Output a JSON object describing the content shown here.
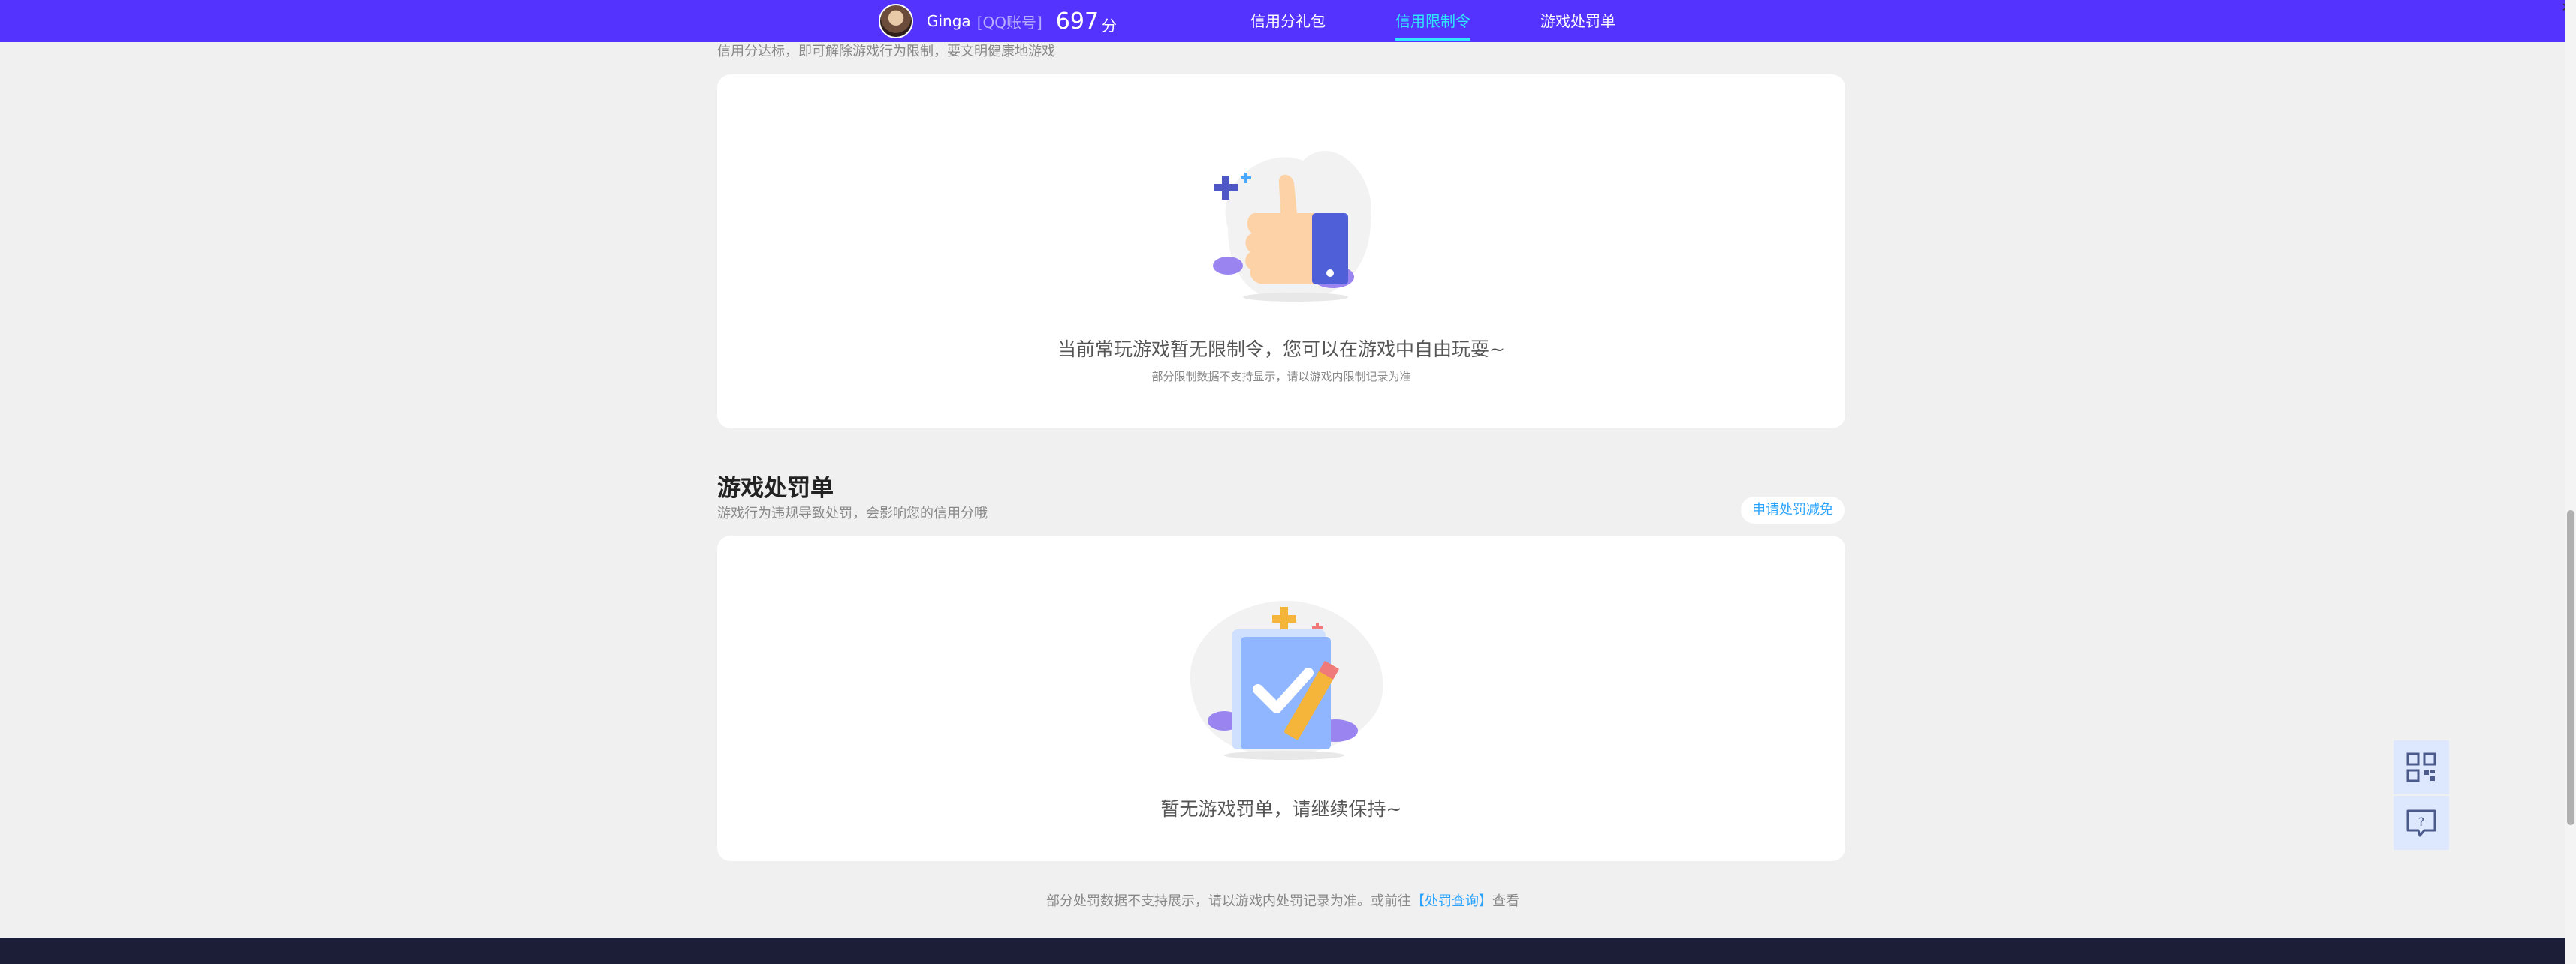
{
  "header": {
    "username": "Ginga",
    "account_tag": "[QQ账号]",
    "score": "697",
    "score_unit": "分",
    "tabs": [
      {
        "label": "信用分礼包",
        "active": false
      },
      {
        "label": "信用限制令",
        "active": true
      },
      {
        "label": "游戏处罚单",
        "active": false
      }
    ]
  },
  "limits": {
    "subtitle": "信用分达标，即可解除游戏行为限制，要文明健康地游戏",
    "empty_main": "当前常玩游戏暂无限制令，您可以在游戏中自由玩耍~",
    "empty_sub": "部分限制数据不支持显示，请以游戏内限制记录为准"
  },
  "penalties": {
    "title": "游戏处罚单",
    "desc": "游戏行为违规导致处罚，会影响您的信用分哦",
    "appeal_label": "申请处罚减免",
    "empty_main": "暂无游戏罚单，请继续保持~"
  },
  "footer": {
    "note_prefix": "部分处罚数据不支持展示，请以游戏内处罚记录为准。或前往",
    "link_label": "【处罚查询】",
    "note_suffix": "查看"
  },
  "colors": {
    "accent": "#5433ff",
    "active_tab": "#2ee6ff",
    "link": "#2aa3ff"
  },
  "icons": {
    "thumbs_up": "thumbs-up-illustration",
    "checklist": "checklist-pencil-illustration",
    "qr": "qr-code-icon",
    "help": "help-chat-icon"
  }
}
